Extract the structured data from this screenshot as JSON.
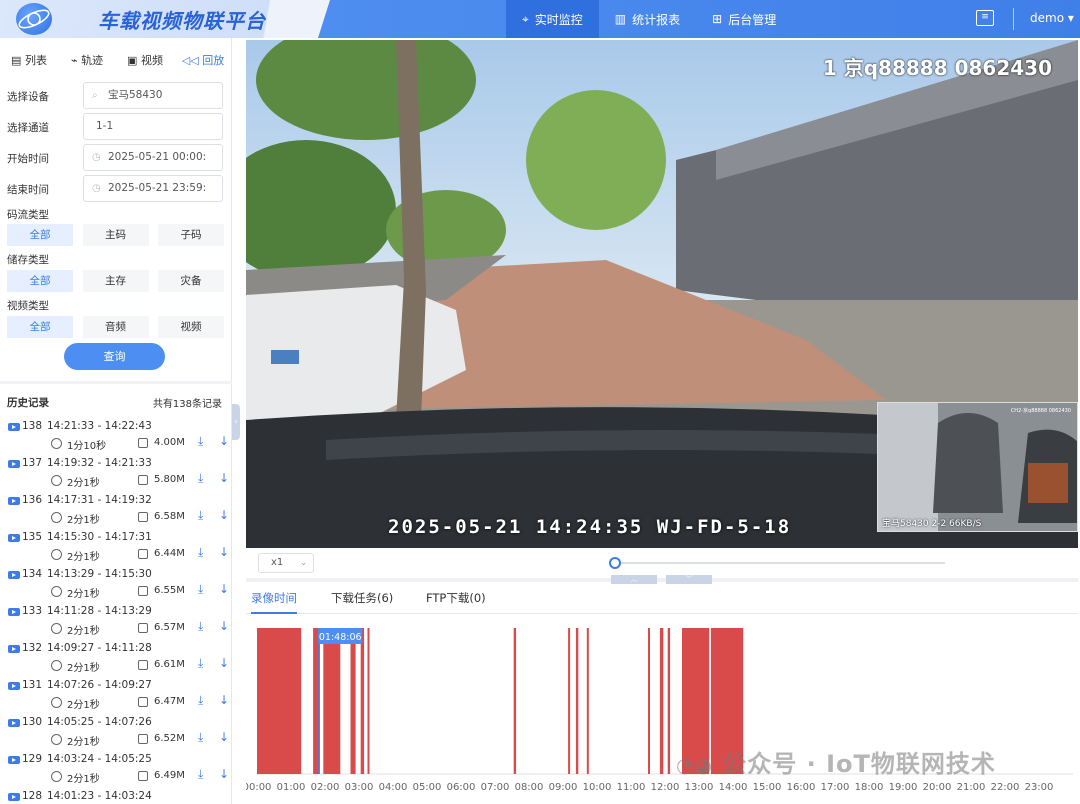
{
  "header": {
    "app_title": "车载视频物联平台",
    "nav": [
      {
        "label": "实时监控",
        "icon": "location-pin-icon",
        "active": true
      },
      {
        "label": "统计报表",
        "icon": "bar-chart-icon",
        "active": false
      },
      {
        "label": "后台管理",
        "icon": "grid-icon",
        "active": false
      }
    ],
    "message_icon": "message-icon",
    "user": "demo ▾"
  },
  "sidebar": {
    "tabs": [
      {
        "label": "列表",
        "icon": "clipboard-icon"
      },
      {
        "label": "轨迹",
        "icon": "route-icon"
      },
      {
        "label": "视频",
        "icon": "video-icon"
      },
      {
        "label": "回放",
        "icon": "rewind-icon",
        "active": true
      }
    ],
    "form": {
      "device_label": "选择设备",
      "device_value": "宝马58430",
      "channel_label": "选择通道",
      "channel_value": "1-1",
      "start_label": "开始时间",
      "start_value": "2025-05-21 00:00:",
      "end_label": "结束时间",
      "end_value": "2025-05-21 23:59:"
    },
    "stream_type": {
      "label": "码流类型",
      "options": [
        "全部",
        "主码",
        "子码"
      ]
    },
    "storage_type": {
      "label": "储存类型",
      "options": [
        "全部",
        "主存",
        "灾备"
      ]
    },
    "video_type": {
      "label": "视频类型",
      "options": [
        "全部",
        "音频",
        "视频"
      ]
    },
    "query_button": "查询",
    "history": {
      "title": "历史记录",
      "count_text": "共有138条记录",
      "records": [
        {
          "id": "138",
          "time": "14:21:33 - 14:22:43",
          "duration": "1分10秒",
          "size": "4.00M"
        },
        {
          "id": "137",
          "time": "14:19:32 - 14:21:33",
          "duration": "2分1秒",
          "size": "5.80M"
        },
        {
          "id": "136",
          "time": "14:17:31 - 14:19:32",
          "duration": "2分1秒",
          "size": "6.58M"
        },
        {
          "id": "135",
          "time": "14:15:30 - 14:17:31",
          "duration": "2分1秒",
          "size": "6.44M"
        },
        {
          "id": "134",
          "time": "14:13:29 - 14:15:30",
          "duration": "2分1秒",
          "size": "6.55M"
        },
        {
          "id": "133",
          "time": "14:11:28 - 14:13:29",
          "duration": "2分1秒",
          "size": "6.57M"
        },
        {
          "id": "132",
          "time": "14:09:27 - 14:11:28",
          "duration": "2分1秒",
          "size": "6.61M"
        },
        {
          "id": "131",
          "time": "14:07:26 - 14:09:27",
          "duration": "2分1秒",
          "size": "6.47M"
        },
        {
          "id": "130",
          "time": "14:05:25 - 14:07:26",
          "duration": "2分1秒",
          "size": "6.52M"
        },
        {
          "id": "129",
          "time": "14:03:24 - 14:05:25",
          "duration": "2分1秒",
          "size": "6.49M"
        },
        {
          "id": "128",
          "time": "14:01:23 - 14:03:24",
          "duration": "",
          "size": ""
        }
      ]
    }
  },
  "video": {
    "osd_top": "1 京q88888 0862430",
    "osd_bottom": "2025-05-21 14:24:35 WJ-FD-5-18",
    "pip_label": "宝马58430   2-2    66KB/S",
    "pip_osd": "CH2-京q88888 0862430"
  },
  "controls": {
    "speed": "x1",
    "progress": 0.0
  },
  "bottom_tabs": [
    {
      "label": "录像时间",
      "active": true
    },
    {
      "label": "下载任务(6)",
      "active": false
    },
    {
      "label": "FTP下载(0)",
      "active": false
    }
  ],
  "timeline": {
    "cursor_label": "01:48:06",
    "cursor_hour": 1.8,
    "hours": [
      "00:00",
      "01:00",
      "02:00",
      "03:00",
      "04:00",
      "05:00",
      "06:00",
      "07:00",
      "08:00",
      "09:00",
      "10:00",
      "11:00",
      "12:00",
      "13:00",
      "14:00",
      "15:00",
      "16:00",
      "17:00",
      "18:00",
      "19:00",
      "20:00",
      "21:00",
      "22:00",
      "23:00"
    ],
    "segments": [
      [
        0.0,
        1.3
      ],
      [
        1.65,
        1.85
      ],
      [
        1.95,
        2.45
      ],
      [
        2.75,
        2.9
      ],
      [
        3.05,
        3.15
      ],
      [
        3.25,
        3.3
      ],
      [
        7.55,
        7.62
      ],
      [
        9.15,
        9.2
      ],
      [
        9.38,
        9.45
      ],
      [
        9.7,
        9.75
      ],
      [
        11.5,
        11.55
      ],
      [
        11.85,
        11.95
      ],
      [
        12.08,
        12.15
      ],
      [
        12.5,
        13.3
      ],
      [
        13.35,
        14.3
      ]
    ],
    "bar_color": "#d94b4b"
  },
  "watermark": "公众号 · IoT物联网技术"
}
